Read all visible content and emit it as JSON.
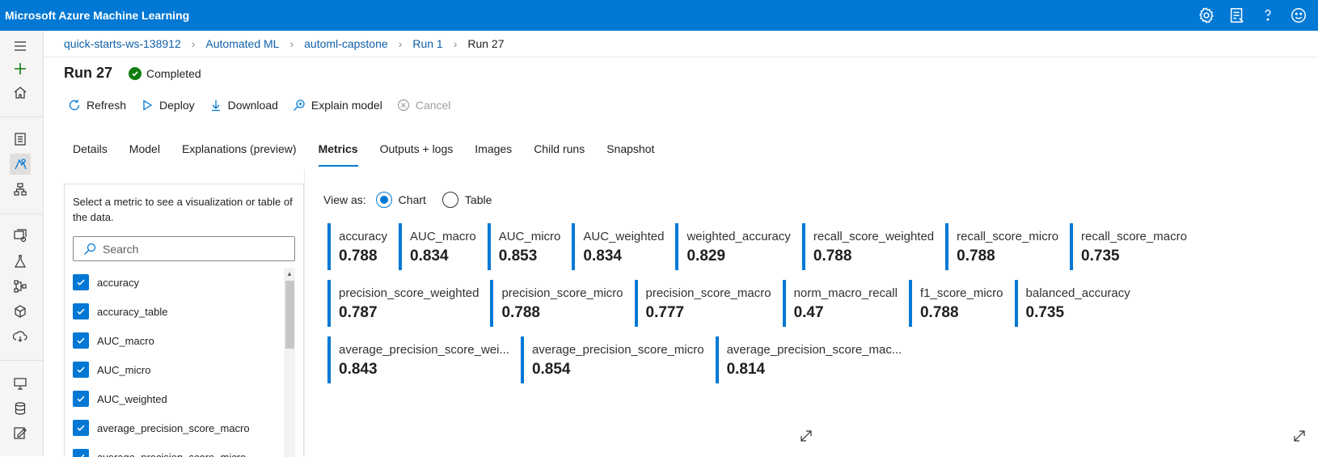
{
  "app": {
    "title": "Microsoft Azure Machine Learning"
  },
  "topbar_icons": [
    "gear-icon",
    "feedback-icon",
    "help-icon",
    "smiley-icon"
  ],
  "breadcrumb": {
    "items": [
      "quick-starts-ws-138912",
      "Automated ML",
      "automl-capstone",
      "Run 1"
    ],
    "current": "Run 27"
  },
  "run": {
    "title": "Run 27",
    "status": "Completed"
  },
  "toolbar": {
    "refresh": "Refresh",
    "deploy": "Deploy",
    "download": "Download",
    "explain": "Explain model",
    "cancel": "Cancel"
  },
  "tabs": [
    "Details",
    "Model",
    "Explanations (preview)",
    "Metrics",
    "Outputs + logs",
    "Images",
    "Child runs",
    "Snapshot"
  ],
  "active_tab": "Metrics",
  "metric_panel": {
    "hint": "Select a metric to see a visualization or table of the data.",
    "search_placeholder": "Search",
    "items": [
      "accuracy",
      "accuracy_table",
      "AUC_macro",
      "AUC_micro",
      "AUC_weighted",
      "average_precision_score_macro",
      "average_precision_score_micro"
    ]
  },
  "view_as": {
    "label": "View as:",
    "chart": "Chart",
    "table": "Table",
    "selected": "Chart"
  },
  "metrics": {
    "row1": [
      {
        "name": "accuracy",
        "value": "0.788"
      },
      {
        "name": "AUC_macro",
        "value": "0.834"
      },
      {
        "name": "AUC_micro",
        "value": "0.853"
      },
      {
        "name": "AUC_weighted",
        "value": "0.834"
      },
      {
        "name": "weighted_accuracy",
        "value": "0.829"
      },
      {
        "name": "recall_score_weighted",
        "value": "0.788"
      },
      {
        "name": "recall_score_micro",
        "value": "0.788"
      },
      {
        "name": "recall_score_macro",
        "value": "0.735"
      }
    ],
    "row2": [
      {
        "name": "precision_score_weighted",
        "value": "0.787"
      },
      {
        "name": "precision_score_micro",
        "value": "0.788"
      },
      {
        "name": "precision_score_macro",
        "value": "0.777"
      },
      {
        "name": "norm_macro_recall",
        "value": "0.47"
      },
      {
        "name": "f1_score_micro",
        "value": "0.788"
      },
      {
        "name": "balanced_accuracy",
        "value": "0.735"
      }
    ],
    "row3": [
      {
        "name": "average_precision_score_wei...",
        "value": "0.843"
      },
      {
        "name": "average_precision_score_micro",
        "value": "0.854"
      },
      {
        "name": "average_precision_score_mac...",
        "value": "0.814"
      }
    ]
  },
  "colors": {
    "brand": "#0078d4",
    "success": "#107c10"
  }
}
